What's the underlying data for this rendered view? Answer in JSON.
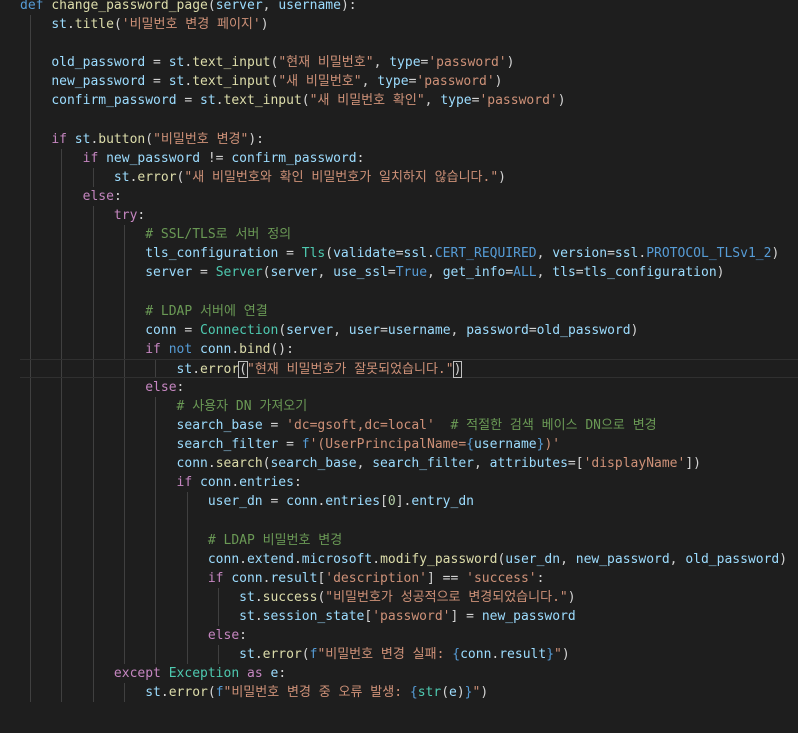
{
  "editor": {
    "colors": {
      "background": "#1e1e1e",
      "keyword_def": "#569cd6",
      "keyword_control": "#c586c0",
      "function": "#dcdcaa",
      "variable": "#9cdcfe",
      "string": "#ce9178",
      "comment": "#6a9955",
      "class": "#4ec9b0",
      "constant": "#569cd6",
      "number": "#b5cea8",
      "default": "#d4d4d4"
    },
    "current_line_index": 18,
    "lines": [
      {
        "indent": 0,
        "tokens": [
          [
            "def",
            "kw"
          ],
          [
            " ",
            "d"
          ],
          [
            "change_password_page",
            "fn"
          ],
          [
            "(",
            "d"
          ],
          [
            "server",
            "var"
          ],
          [
            ", ",
            "d"
          ],
          [
            "username",
            "var"
          ],
          [
            "):",
            "d"
          ]
        ]
      },
      {
        "indent": 1,
        "tokens": [
          [
            "st",
            "var"
          ],
          [
            ".",
            "d"
          ],
          [
            "title",
            "fn"
          ],
          [
            "(",
            "d"
          ],
          [
            "'비밀번호 변경 페이지'",
            "str"
          ],
          [
            ")",
            "d"
          ]
        ]
      },
      {
        "indent": 1,
        "tokens": []
      },
      {
        "indent": 1,
        "tokens": [
          [
            "old_password",
            "var"
          ],
          [
            " = ",
            "d"
          ],
          [
            "st",
            "var"
          ],
          [
            ".",
            "d"
          ],
          [
            "text_input",
            "fn"
          ],
          [
            "(",
            "d"
          ],
          [
            "\"현재 비밀번호\"",
            "str"
          ],
          [
            ", ",
            "d"
          ],
          [
            "type",
            "var"
          ],
          [
            "=",
            "d"
          ],
          [
            "'password'",
            "str"
          ],
          [
            ")",
            "d"
          ]
        ]
      },
      {
        "indent": 1,
        "tokens": [
          [
            "new_password",
            "var"
          ],
          [
            " = ",
            "d"
          ],
          [
            "st",
            "var"
          ],
          [
            ".",
            "d"
          ],
          [
            "text_input",
            "fn"
          ],
          [
            "(",
            "d"
          ],
          [
            "\"새 비밀번호\"",
            "str"
          ],
          [
            ", ",
            "d"
          ],
          [
            "type",
            "var"
          ],
          [
            "=",
            "d"
          ],
          [
            "'password'",
            "str"
          ],
          [
            ")",
            "d"
          ]
        ]
      },
      {
        "indent": 1,
        "tokens": [
          [
            "confirm_password",
            "var"
          ],
          [
            " = ",
            "d"
          ],
          [
            "st",
            "var"
          ],
          [
            ".",
            "d"
          ],
          [
            "text_input",
            "fn"
          ],
          [
            "(",
            "d"
          ],
          [
            "\"새 비밀번호 확인\"",
            "str"
          ],
          [
            ", ",
            "d"
          ],
          [
            "type",
            "var"
          ],
          [
            "=",
            "d"
          ],
          [
            "'password'",
            "str"
          ],
          [
            ")",
            "d"
          ]
        ]
      },
      {
        "indent": 1,
        "tokens": []
      },
      {
        "indent": 1,
        "tokens": [
          [
            "if",
            "ctl"
          ],
          [
            " ",
            "d"
          ],
          [
            "st",
            "var"
          ],
          [
            ".",
            "d"
          ],
          [
            "button",
            "fn"
          ],
          [
            "(",
            "d"
          ],
          [
            "\"비밀번호 변경\"",
            "str"
          ],
          [
            "):",
            "d"
          ]
        ]
      },
      {
        "indent": 2,
        "tokens": [
          [
            "if",
            "ctl"
          ],
          [
            " ",
            "d"
          ],
          [
            "new_password",
            "var"
          ],
          [
            " != ",
            "d"
          ],
          [
            "confirm_password",
            "var"
          ],
          [
            ":",
            "d"
          ]
        ]
      },
      {
        "indent": 3,
        "tokens": [
          [
            "st",
            "var"
          ],
          [
            ".",
            "d"
          ],
          [
            "error",
            "fn"
          ],
          [
            "(",
            "d"
          ],
          [
            "\"새 비밀번호와 확인 비밀번호가 일치하지 않습니다.\"",
            "str"
          ],
          [
            ")",
            "d"
          ]
        ]
      },
      {
        "indent": 2,
        "tokens": [
          [
            "else",
            "ctl"
          ],
          [
            ":",
            "d"
          ]
        ]
      },
      {
        "indent": 3,
        "tokens": [
          [
            "try",
            "ctl"
          ],
          [
            ":",
            "d"
          ]
        ]
      },
      {
        "indent": 4,
        "tokens": [
          [
            "# SSL/TLS로 서버 정의",
            "cm"
          ]
        ]
      },
      {
        "indent": 4,
        "tokens": [
          [
            "tls_configuration",
            "var"
          ],
          [
            " = ",
            "d"
          ],
          [
            "Tls",
            "cls"
          ],
          [
            "(",
            "d"
          ],
          [
            "validate",
            "var"
          ],
          [
            "=",
            "d"
          ],
          [
            "ssl",
            "var"
          ],
          [
            ".",
            "d"
          ],
          [
            "CERT_REQUIRED",
            "const"
          ],
          [
            ", ",
            "d"
          ],
          [
            "version",
            "var"
          ],
          [
            "=",
            "d"
          ],
          [
            "ssl",
            "var"
          ],
          [
            ".",
            "d"
          ],
          [
            "PROTOCOL_TLSv1_2",
            "const"
          ],
          [
            ")",
            "d"
          ]
        ]
      },
      {
        "indent": 4,
        "tokens": [
          [
            "server",
            "var"
          ],
          [
            " = ",
            "d"
          ],
          [
            "Server",
            "cls"
          ],
          [
            "(",
            "d"
          ],
          [
            "server",
            "var"
          ],
          [
            ", ",
            "d"
          ],
          [
            "use_ssl",
            "var"
          ],
          [
            "=",
            "d"
          ],
          [
            "True",
            "kw"
          ],
          [
            ", ",
            "d"
          ],
          [
            "get_info",
            "var"
          ],
          [
            "=",
            "d"
          ],
          [
            "ALL",
            "const"
          ],
          [
            ", ",
            "d"
          ],
          [
            "tls",
            "var"
          ],
          [
            "=",
            "d"
          ],
          [
            "tls_configuration",
            "var"
          ],
          [
            ")",
            "d"
          ]
        ]
      },
      {
        "indent": 4,
        "tokens": []
      },
      {
        "indent": 4,
        "tokens": [
          [
            "# LDAP 서버에 연결",
            "cm"
          ]
        ]
      },
      {
        "indent": 4,
        "tokens": [
          [
            "conn",
            "var"
          ],
          [
            " = ",
            "d"
          ],
          [
            "Connection",
            "cls"
          ],
          [
            "(",
            "d"
          ],
          [
            "server",
            "var"
          ],
          [
            ", ",
            "d"
          ],
          [
            "user",
            "var"
          ],
          [
            "=",
            "d"
          ],
          [
            "username",
            "var"
          ],
          [
            ", ",
            "d"
          ],
          [
            "password",
            "var"
          ],
          [
            "=",
            "d"
          ],
          [
            "old_password",
            "var"
          ],
          [
            ")",
            "d"
          ]
        ]
      },
      {
        "indent": 4,
        "tokens": [
          [
            "if",
            "ctl"
          ],
          [
            " ",
            "d"
          ],
          [
            "not",
            "kw"
          ],
          [
            " ",
            "d"
          ],
          [
            "conn",
            "var"
          ],
          [
            ".",
            "d"
          ],
          [
            "bind",
            "fn"
          ],
          [
            "():",
            "d"
          ]
        ]
      },
      {
        "indent": 5,
        "cursor": true,
        "tokens": [
          [
            "st",
            "var"
          ],
          [
            ".",
            "d"
          ],
          [
            "error",
            "fn"
          ],
          [
            "(",
            "box"
          ],
          [
            "\"현재 비밀번호가 잘못되었습니다.\"",
            "str"
          ],
          [
            ")",
            "box"
          ]
        ]
      },
      {
        "indent": 4,
        "tokens": [
          [
            "else",
            "ctl"
          ],
          [
            ":",
            "d"
          ]
        ]
      },
      {
        "indent": 5,
        "tokens": [
          [
            "# 사용자 DN 가져오기",
            "cm"
          ]
        ]
      },
      {
        "indent": 5,
        "tokens": [
          [
            "search_base",
            "var"
          ],
          [
            " = ",
            "d"
          ],
          [
            "'dc=gsoft,dc=local'",
            "str"
          ],
          [
            "  ",
            "d"
          ],
          [
            "# 적절한 검색 베이스 DN으로 변경",
            "cm"
          ]
        ]
      },
      {
        "indent": 5,
        "tokens": [
          [
            "search_filter",
            "var"
          ],
          [
            " = ",
            "d"
          ],
          [
            "f",
            "kw"
          ],
          [
            "'(UserPrincipalName=",
            "str"
          ],
          [
            "{",
            "kw"
          ],
          [
            "username",
            "var"
          ],
          [
            "}",
            "kw"
          ],
          [
            ")'",
            "str"
          ]
        ]
      },
      {
        "indent": 5,
        "tokens": [
          [
            "conn",
            "var"
          ],
          [
            ".",
            "d"
          ],
          [
            "search",
            "fn"
          ],
          [
            "(",
            "d"
          ],
          [
            "search_base",
            "var"
          ],
          [
            ", ",
            "d"
          ],
          [
            "search_filter",
            "var"
          ],
          [
            ", ",
            "d"
          ],
          [
            "attributes",
            "var"
          ],
          [
            "=",
            "d"
          ],
          [
            "[",
            "d"
          ],
          [
            "'displayName'",
            "str"
          ],
          [
            "])",
            "d"
          ]
        ]
      },
      {
        "indent": 5,
        "tokens": [
          [
            "if",
            "ctl"
          ],
          [
            " ",
            "d"
          ],
          [
            "conn",
            "var"
          ],
          [
            ".",
            "d"
          ],
          [
            "entries",
            "var"
          ],
          [
            ":",
            "d"
          ]
        ]
      },
      {
        "indent": 6,
        "tokens": [
          [
            "user_dn",
            "var"
          ],
          [
            " = ",
            "d"
          ],
          [
            "conn",
            "var"
          ],
          [
            ".",
            "d"
          ],
          [
            "entries",
            "var"
          ],
          [
            "[",
            "d"
          ],
          [
            "0",
            "num"
          ],
          [
            "]",
            "d"
          ],
          [
            ".",
            "d"
          ],
          [
            "entry_dn",
            "var"
          ]
        ]
      },
      {
        "indent": 6,
        "tokens": []
      },
      {
        "indent": 6,
        "tokens": [
          [
            "# LDAP 비밀번호 변경",
            "cm"
          ]
        ]
      },
      {
        "indent": 6,
        "tokens": [
          [
            "conn",
            "var"
          ],
          [
            ".",
            "d"
          ],
          [
            "extend",
            "var"
          ],
          [
            ".",
            "d"
          ],
          [
            "microsoft",
            "var"
          ],
          [
            ".",
            "d"
          ],
          [
            "modify_password",
            "fn"
          ],
          [
            "(",
            "d"
          ],
          [
            "user_dn",
            "var"
          ],
          [
            ", ",
            "d"
          ],
          [
            "new_password",
            "var"
          ],
          [
            ", ",
            "d"
          ],
          [
            "old_password",
            "var"
          ],
          [
            ")",
            "d"
          ]
        ]
      },
      {
        "indent": 6,
        "tokens": [
          [
            "if",
            "ctl"
          ],
          [
            " ",
            "d"
          ],
          [
            "conn",
            "var"
          ],
          [
            ".",
            "d"
          ],
          [
            "result",
            "var"
          ],
          [
            "[",
            "d"
          ],
          [
            "'description'",
            "str"
          ],
          [
            "] == ",
            "d"
          ],
          [
            "'success'",
            "str"
          ],
          [
            ":",
            "d"
          ]
        ]
      },
      {
        "indent": 7,
        "tokens": [
          [
            "st",
            "var"
          ],
          [
            ".",
            "d"
          ],
          [
            "success",
            "fn"
          ],
          [
            "(",
            "d"
          ],
          [
            "\"비밀번호가 성공적으로 변경되었습니다.\"",
            "str"
          ],
          [
            ")",
            "d"
          ]
        ]
      },
      {
        "indent": 7,
        "tokens": [
          [
            "st",
            "var"
          ],
          [
            ".",
            "d"
          ],
          [
            "session_state",
            "var"
          ],
          [
            "[",
            "d"
          ],
          [
            "'password'",
            "str"
          ],
          [
            "] = ",
            "d"
          ],
          [
            "new_password",
            "var"
          ]
        ]
      },
      {
        "indent": 6,
        "tokens": [
          [
            "else",
            "ctl"
          ],
          [
            ":",
            "d"
          ]
        ]
      },
      {
        "indent": 7,
        "tokens": [
          [
            "st",
            "var"
          ],
          [
            ".",
            "d"
          ],
          [
            "error",
            "fn"
          ],
          [
            "(",
            "d"
          ],
          [
            "f",
            "kw"
          ],
          [
            "\"비밀번호 변경 실패: ",
            "str"
          ],
          [
            "{",
            "kw"
          ],
          [
            "conn",
            "var"
          ],
          [
            ".",
            "d"
          ],
          [
            "result",
            "var"
          ],
          [
            "}",
            "kw"
          ],
          [
            "\"",
            "str"
          ],
          [
            ")",
            "d"
          ]
        ]
      },
      {
        "indent": 3,
        "tokens": [
          [
            "except",
            "ctl"
          ],
          [
            " ",
            "d"
          ],
          [
            "Exception",
            "cls"
          ],
          [
            " ",
            "d"
          ],
          [
            "as",
            "ctl"
          ],
          [
            " ",
            "d"
          ],
          [
            "e",
            "var"
          ],
          [
            ":",
            "d"
          ]
        ]
      },
      {
        "indent": 4,
        "tokens": [
          [
            "st",
            "var"
          ],
          [
            ".",
            "d"
          ],
          [
            "error",
            "fn"
          ],
          [
            "(",
            "d"
          ],
          [
            "f",
            "kw"
          ],
          [
            "\"비밀번호 변경 중 오류 발생: ",
            "str"
          ],
          [
            "{",
            "kw"
          ],
          [
            "str",
            "cls"
          ],
          [
            "(",
            "d"
          ],
          [
            "e",
            "var"
          ],
          [
            ")",
            "d"
          ],
          [
            "}",
            "kw"
          ],
          [
            "\"",
            "str"
          ],
          [
            ")",
            "d"
          ]
        ]
      }
    ]
  }
}
